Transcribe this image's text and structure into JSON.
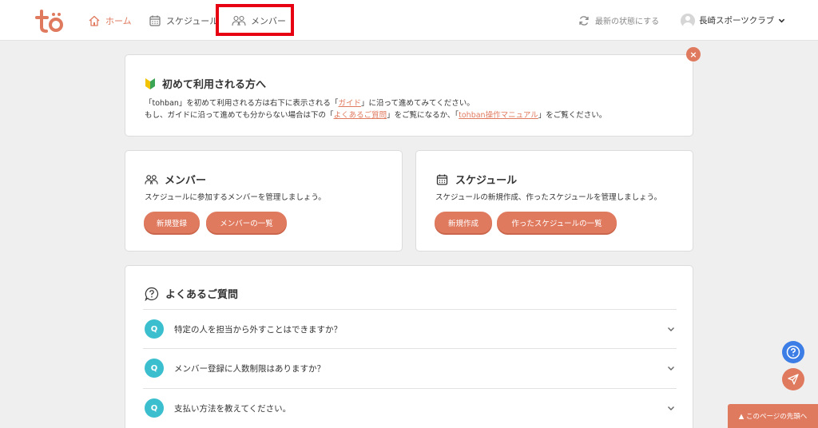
{
  "header": {
    "logo_text": "to",
    "nav": {
      "home": "ホーム",
      "schedule": "スケジュール",
      "member": "メンバー"
    },
    "refresh_label": "最新の状態にする",
    "account_name": "長崎スポーツクラブ"
  },
  "guide": {
    "title": "初めて利用される方へ",
    "line1_pre": "「tohban」を初めて利用される方は右下に表示される「",
    "line1_link": "ガイド",
    "line1_post": "」に沿って進めてみてください。",
    "line2_pre": "もし、ガイドに沿って進めても分からない場合は下の「",
    "line2_link1": "よくあるご質問",
    "line2_mid": "」をご覧になるか、「",
    "line2_link2": "tohban操作マニュアル",
    "line2_post": "」をご覧ください。",
    "close_symbol": "×"
  },
  "member_card": {
    "title": "メンバー",
    "desc": "スケジュールに参加するメンバーを管理しましょう。",
    "btn_new": "新規登録",
    "btn_list": "メンバーの一覧"
  },
  "schedule_card": {
    "title": "スケジュール",
    "desc": "スケジュールの新規作成、作ったスケジュールを管理しましょう。",
    "btn_new": "新規作成",
    "btn_list": "作ったスケジュールの一覧"
  },
  "faq": {
    "title": "よくあるご質問",
    "badge": "Q",
    "items": [
      {
        "q": "特定の人を担当から外すことはできますか？"
      },
      {
        "q": "メンバー登録に人数制限はありますか？"
      },
      {
        "q": "支払い方法を教えてください。"
      }
    ]
  },
  "to_top_label": "▲ このページの先頭へ",
  "colors": {
    "accent": "#e07a5f",
    "faq_badge": "#3bbfcf",
    "help": "#3c7de6",
    "highlight": "#e60012"
  }
}
